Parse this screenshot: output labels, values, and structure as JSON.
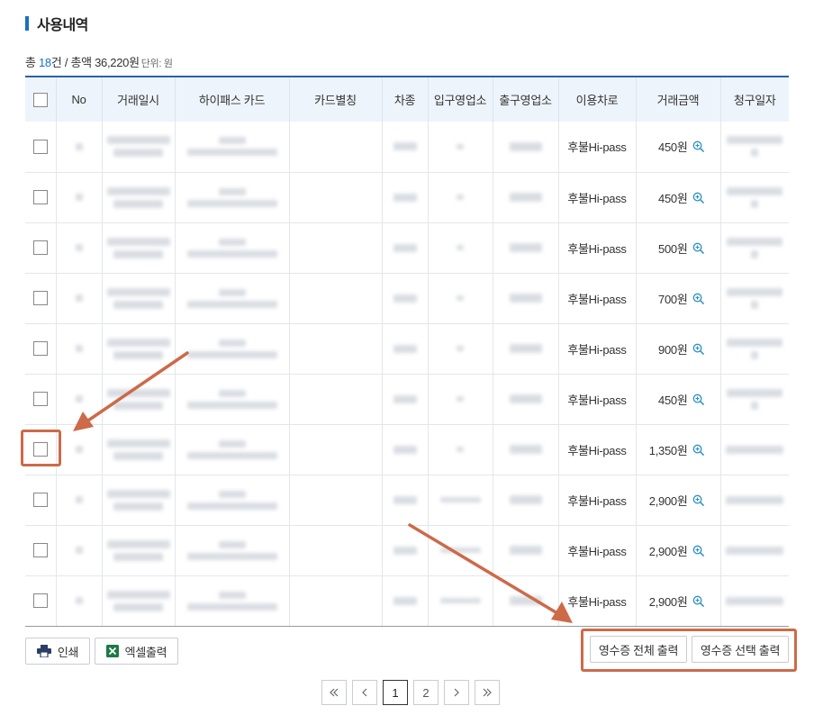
{
  "section": {
    "title": "사용내역"
  },
  "summary": {
    "prefix": "총 ",
    "count": "18",
    "count_suffix": "건",
    "sep": " / 총액 ",
    "total": "36,220원",
    "unit": "단위: 원"
  },
  "table": {
    "headers": [
      "",
      "No",
      "거래일시",
      "하이패스 카드",
      "카드별칭",
      "차종",
      "입구영업소",
      "출구영업소",
      "이용차로",
      "거래금액",
      "청구일자"
    ],
    "rows": [
      {
        "lane": "후불Hi-pass",
        "amount": "450원"
      },
      {
        "lane": "후불Hi-pass",
        "amount": "450원"
      },
      {
        "lane": "후불Hi-pass",
        "amount": "500원"
      },
      {
        "lane": "후불Hi-pass",
        "amount": "700원"
      },
      {
        "lane": "후불Hi-pass",
        "amount": "900원"
      },
      {
        "lane": "후불Hi-pass",
        "amount": "450원"
      },
      {
        "lane": "후불Hi-pass",
        "amount": "1,350원"
      },
      {
        "lane": "후불Hi-pass",
        "amount": "2,900원"
      },
      {
        "lane": "후불Hi-pass",
        "amount": "2,900원"
      },
      {
        "lane": "후불Hi-pass",
        "amount": "2,900원"
      }
    ]
  },
  "buttons": {
    "print": "인쇄",
    "excel": "엑셀출력",
    "receipt_all": "영수증 전체 출력",
    "receipt_selected": "영수증 선택 출력"
  },
  "pagination": {
    "pages": [
      "1",
      "2"
    ],
    "current": "1"
  },
  "colors": {
    "accent": "#1a6fc4",
    "annotation": "#cd6a48",
    "zoom": "#2a8fc4"
  }
}
